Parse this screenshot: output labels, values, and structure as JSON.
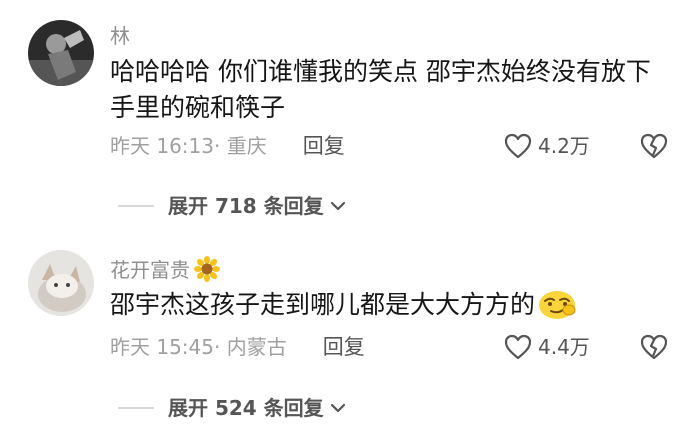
{
  "comments": [
    {
      "username": "林",
      "text": "哈哈哈哈 你们谁懂我的笑点  邵宇杰始终没有放下手里的碗和筷子",
      "time": "昨天 16:13",
      "location": "· 重庆",
      "reply_label": "回复",
      "likes": "4.2万",
      "expand_label": "展开 718 条回复"
    },
    {
      "username": "花开富贵",
      "username_badge_icon": "sunflower-icon",
      "text": "邵宇杰这孩子走到哪儿都是大大方方的",
      "text_emoji_icon": "smug-face-emoji-icon",
      "time": "昨天 15:45",
      "location": "· 内蒙古",
      "reply_label": "回复",
      "likes": "4.4万",
      "expand_label": "展开 524 条回复"
    }
  ],
  "colors": {
    "meta_text": "#a0a0a0",
    "username": "#8f8f8f",
    "body_text": "#161616",
    "divider": "#d9d9d9"
  }
}
